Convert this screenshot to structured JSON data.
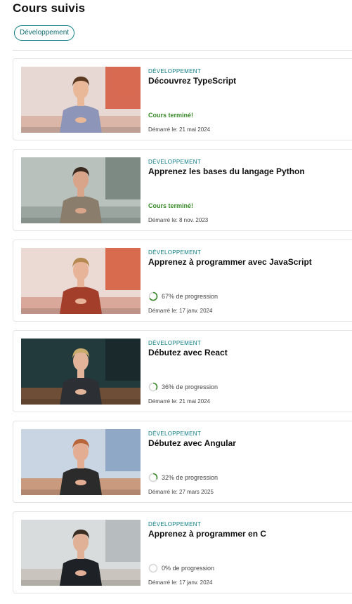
{
  "page": {
    "title": "Cours suivis"
  },
  "filters": {
    "active": "Développement"
  },
  "courses": [
    {
      "category": "DÉVELOPPEMENT",
      "title": "Découvrez TypeScript",
      "status": "done",
      "status_text": "Cours terminé!",
      "started": "Démarré le: 21 mai 2024",
      "thumb": {
        "bg": "#e8d8d3",
        "wall2": "#d76a52",
        "floor": "#d9b6a8",
        "shirt": "#8d96b8",
        "hair": "#5c3a22",
        "skin": "#e8b899"
      }
    },
    {
      "category": "DÉVELOPPEMENT",
      "title": "Apprenez les bases du langage Python",
      "status": "done",
      "status_text": "Cours terminé!",
      "started": "Démarré le: 8 nov. 2023",
      "thumb": {
        "bg": "#b9c1bd",
        "wall2": "#7d8a84",
        "floor": "#9aa59f",
        "shirt": "#8a7d6c",
        "hair": "#3a2a1f",
        "skin": "#d9a58a"
      }
    },
    {
      "category": "DÉVELOPPEMENT",
      "title": "Apprenez à programmer avec JavaScript",
      "status": "progress",
      "progress_pct": 67,
      "progress_text": "67% de progression",
      "started": "Démarré le: 17 janv. 2024",
      "thumb": {
        "bg": "#eadad3",
        "wall2": "#d86a4e",
        "floor": "#d9a89a",
        "shirt": "#a23e2a",
        "hair": "#b58852",
        "skin": "#e8b499"
      }
    },
    {
      "category": "DÉVELOPPEMENT",
      "title": "Débutez avec React",
      "status": "progress",
      "progress_pct": 36,
      "progress_text": "36% de progression",
      "started": "Démarré le: 21 mai 2024",
      "thumb": {
        "bg": "#233a3c",
        "wall2": "#1a2a2c",
        "floor": "#6e4e36",
        "shirt": "#2c2f33",
        "hair": "#c9ab6e",
        "skin": "#e2b59a"
      }
    },
    {
      "category": "DÉVELOPPEMENT",
      "title": "Débutez avec Angular",
      "status": "progress",
      "progress_pct": 32,
      "progress_text": "32% de progression",
      "started": "Démarré le: 27 mars 2025",
      "thumb": {
        "bg": "#c9d5e3",
        "wall2": "#8ea8c6",
        "floor": "#c99a7d",
        "shirt": "#2b2b2b",
        "hair": "#b9653b",
        "skin": "#e2ad93"
      }
    },
    {
      "category": "DÉVELOPPEMENT",
      "title": "Apprenez à programmer en C",
      "status": "progress",
      "progress_pct": 0,
      "progress_text": "0% de progression",
      "started": "Démarré le: 17 janv. 2024",
      "thumb": {
        "bg": "#d9dcdd",
        "wall2": "#b7bcbe",
        "floor": "#c9c4bd",
        "shirt": "#1e2126",
        "hair": "#3a2d24",
        "skin": "#e0b196"
      }
    }
  ],
  "colors": {
    "accent": "#0e7c86",
    "done": "#3a8a2b",
    "progress_ring": "#3a8a2b",
    "ring_track": "#d6d6d6"
  }
}
